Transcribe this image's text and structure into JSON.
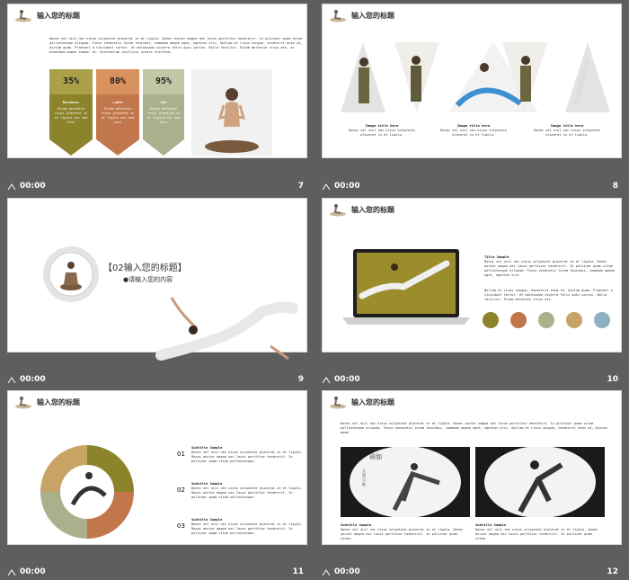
{
  "slide_title": "输入您的标题",
  "footer_time": "00:00",
  "colors": {
    "olive": "#8b842a",
    "rust": "#c2764b",
    "sage": "#a9b08b",
    "tan": "#c7a366",
    "blue": "#8fb0c0",
    "bg": "#5e5e5e"
  },
  "slides": [
    {
      "number": "7",
      "body": "Donec vel nisl nec nisus vulputate placerat in et ligula. Donec auctor magna nec lacus porttitor hendrerit. In pulvinar quam vitae pellentesque aliquam. Fusce venenatis lorem faucibus, commodo magna eget, egestas orci. Nullam et risus congue, hendrerit enim id, dictum quam. Praesent a tincidunt tortor. Ut malesuada viverra felis quis varius. Nulla facilisi. Etiam molestie risus est, ac bibendum magna tempor at. Vestibulum facilisis ornare eleifend.",
      "stats": [
        {
          "value": "35%",
          "label": "Business",
          "text": "Etiam molestie risus placerat in et ligula nec sed nisi"
        },
        {
          "value": "80%",
          "label": "Ludie",
          "text": "Etiam molestie risus placerat in et ligula nec sed nisi"
        },
        {
          "value": "95%",
          "label": "USA",
          "text": "Etiam molestie risus placerat in et ligula nec sed nisi"
        }
      ]
    },
    {
      "number": "8",
      "captions": [
        {
          "title": "Image title here",
          "text": "Donec vel nisl nec nisus vulputate placerat in et ligula."
        },
        {
          "title": "Image title here",
          "text": "Donec vel nisl nec nisus vulputate placerat in et ligula."
        },
        {
          "title": "Image title here",
          "text": "Donec vel nisl nec nisus vulputate placerat in et ligula."
        }
      ]
    },
    {
      "number": "9",
      "heading": "【02输入您的标题】",
      "subheading": "●请输入您的内容"
    },
    {
      "number": "10",
      "title": "Title Sample",
      "para1": "Donec vel nisl nec nisus vulputate placerat in et ligula. Donec auctor magna nec lacus porttitor hendrerit. In pulvinar quam vitae pellentesque aliquam. Fusce venenatis lorem faucibus, commodo magna eget, egestas orci.",
      "para2": "Nullam et risus congue, hendrerit enim id, dictum quam. Praesent a tincidunt tortor. Ut malesuada viverra felis quis varius. Nulla facilisi. Etiam molestie risus est."
    },
    {
      "number": "11",
      "items": [
        {
          "num": "01",
          "title": "Subtitle Sample",
          "text": "Donec vel nisl nec nisus vulputate placerat in et ligula. Donec auctor magna nec lacus porttitor hendrerit. In pulvinar quam vitae pellentesque."
        },
        {
          "num": "02",
          "title": "Subtitle Sample",
          "text": "Donec vel nisl nec nisus vulputate placerat in et ligula. Donec auctor magna nec lacus porttitor hendrerit. In pulvinar quam vitae pellentesque."
        },
        {
          "num": "03",
          "title": "Subtitle Sample",
          "text": "Donec vel nisl nec nisus vulputate placerat in et ligula. Donec auctor magna nec lacus porttitor hendrerit. In pulvinar quam vitae pellentesque."
        }
      ]
    },
    {
      "number": "12",
      "body": "Donec vel nisl nec nisus vulputate placerat in et ligula. Donec auctor magna nec lacus porttitor hendrerit. In pulvinar quam vitae pellentesque aliquam. Fusce venenatis lorem faucibus, commodo magna eget, egestas orci. Nullam et risus congue, hendrerit enim id, dictum quam.",
      "yoga_text": "瑜伽",
      "vertical_text": "无限可能",
      "captions": [
        {
          "title": "Subtitle Sample",
          "text": "Donec vel nisl nec nisus vulputate placerat in et ligula. Donec auctor magna nec lacus porttitor hendrerit. In pulvinar quam vitae."
        },
        {
          "title": "Subtitle Sample",
          "text": "Donec vel nisl nec nisus vulputate placerat in et ligula. Donec auctor magna nec lacus porttitor hendrerit. In pulvinar quam vitae."
        }
      ]
    }
  ]
}
